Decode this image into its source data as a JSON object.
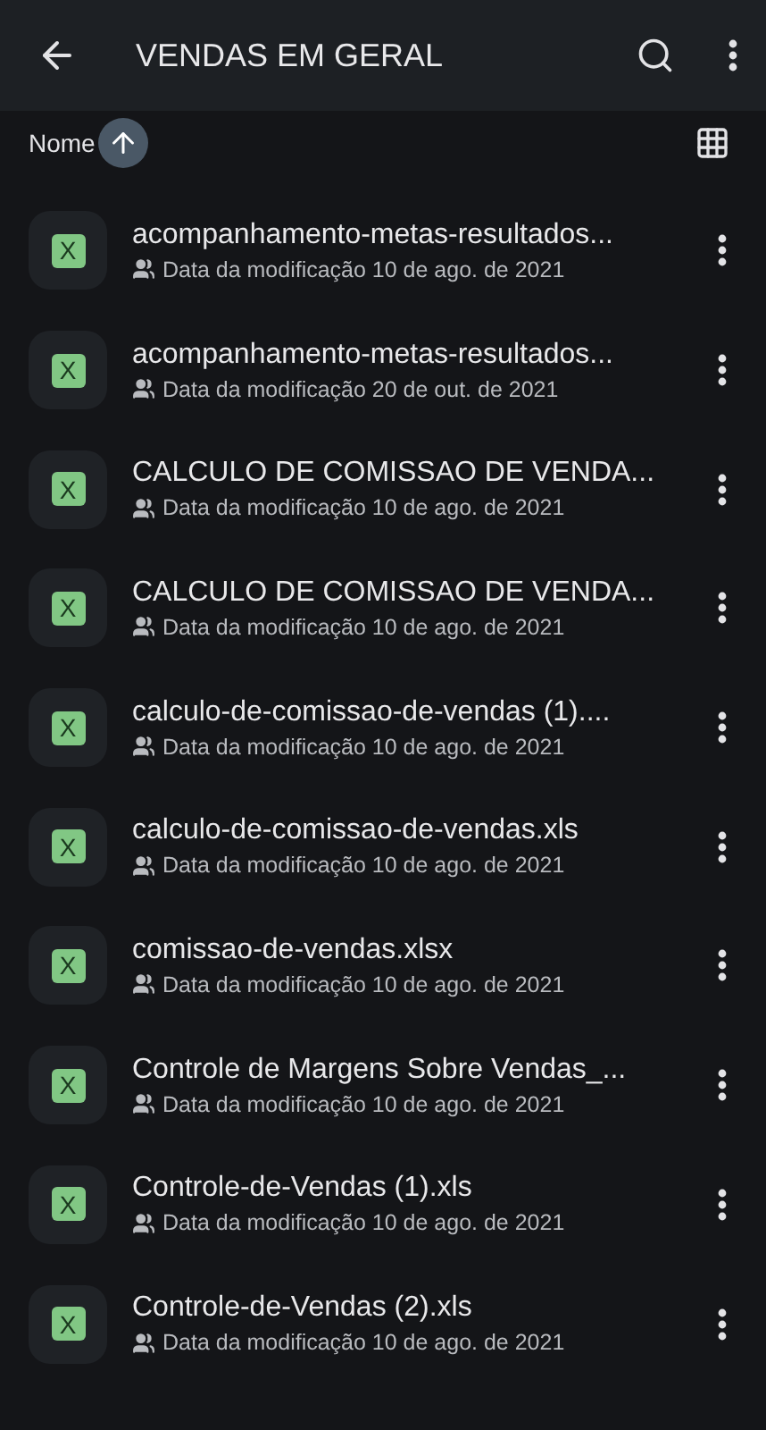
{
  "app_bar": {
    "title": "VENDAS EM GERAL"
  },
  "sort": {
    "label": "Nome"
  },
  "files": [
    {
      "name": "acompanhamento-metas-resultados...",
      "type_label": "X",
      "shared": true,
      "modified": "Data da modificação 10 de ago. de 2021"
    },
    {
      "name": "acompanhamento-metas-resultados...",
      "type_label": "X",
      "shared": true,
      "modified": "Data da modificação 20 de out. de 2021"
    },
    {
      "name": "CALCULO DE COMISSAO DE VENDA...",
      "type_label": "X",
      "shared": true,
      "modified": "Data da modificação 10 de ago. de 2021"
    },
    {
      "name": "CALCULO DE COMISSAO DE VENDA...",
      "type_label": "X",
      "shared": true,
      "modified": "Data da modificação 10 de ago. de 2021"
    },
    {
      "name": "calculo-de-comissao-de-vendas (1)....",
      "type_label": "X",
      "shared": true,
      "modified": "Data da modificação 10 de ago. de 2021"
    },
    {
      "name": "calculo-de-comissao-de-vendas.xls",
      "type_label": "X",
      "shared": true,
      "modified": "Data da modificação 10 de ago. de 2021"
    },
    {
      "name": "comissao-de-vendas.xlsx",
      "type_label": "X",
      "shared": true,
      "modified": "Data da modificação 10 de ago. de 2021"
    },
    {
      "name": "Controle de Margens Sobre Vendas_...",
      "type_label": "X",
      "shared": true,
      "modified": "Data da modificação 10 de ago. de 2021"
    },
    {
      "name": "Controle-de-Vendas (1).xls",
      "type_label": "X",
      "shared": true,
      "modified": "Data da modificação 10 de ago. de 2021"
    },
    {
      "name": "Controle-de-Vendas (2).xls",
      "type_label": "X",
      "shared": true,
      "modified": "Data da modificação 10 de ago. de 2021"
    }
  ]
}
